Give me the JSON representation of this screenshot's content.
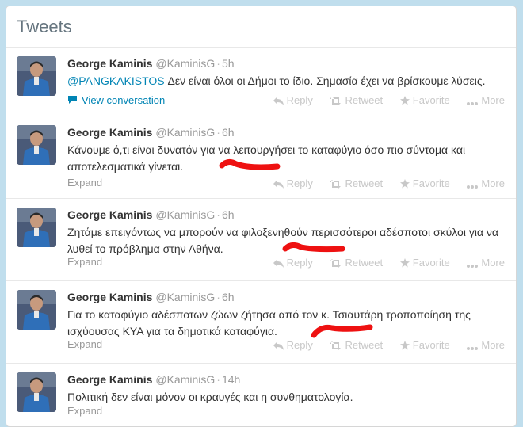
{
  "header": {
    "title": "Tweets"
  },
  "actions": {
    "reply": "Reply",
    "retweet": "Retweet",
    "favorite": "Favorite",
    "more": "More"
  },
  "tweets": [
    {
      "fullname": "George Kaminis",
      "username": "@KaminisG",
      "time": "5h",
      "mention": "@PANGKAKISTOS",
      "text": " Δεν είναι όλοι οι Δήμοι το ίδιο. Σημασία έχει να βρίσκουμε λύσεις.",
      "footer": "View conversation"
    },
    {
      "fullname": "George Kaminis",
      "username": "@KaminisG",
      "time": "6h",
      "text": "Κάνουμε ό,τι είναι δυνατόν για να λειτουργήσει το καταφύγιο όσο πιο σύντομα και αποτελεσματικά γίνεται.",
      "footer": "Expand"
    },
    {
      "fullname": "George Kaminis",
      "username": "@KaminisG",
      "time": "6h",
      "text": "Ζητάμε επειγόντως να μπορούν να φιλοξενηθούν περισσότεροι αδέσποτοι σκύλοι για να λυθεί το πρόβλημα στην Αθήνα.",
      "footer": "Expand"
    },
    {
      "fullname": "George Kaminis",
      "username": "@KaminisG",
      "time": "6h",
      "text": "Για το καταφύγιο αδέσποτων ζώων ζήτησα από τον κ. Τσιαυτάρη τροποποίηση της ισχύουσας ΚΥΑ για τα δημοτικά καταφύγια.",
      "footer": "Expand"
    },
    {
      "fullname": "George Kaminis",
      "username": "@KaminisG",
      "time": "14h",
      "text": "Πολιτική δεν είναι μόνον οι κραυγές και η συνθηματολογία.",
      "footer": "Expand"
    }
  ],
  "colors": {
    "background": "#c0deed",
    "link": "#0084b4",
    "annotation": "#ee1111"
  }
}
